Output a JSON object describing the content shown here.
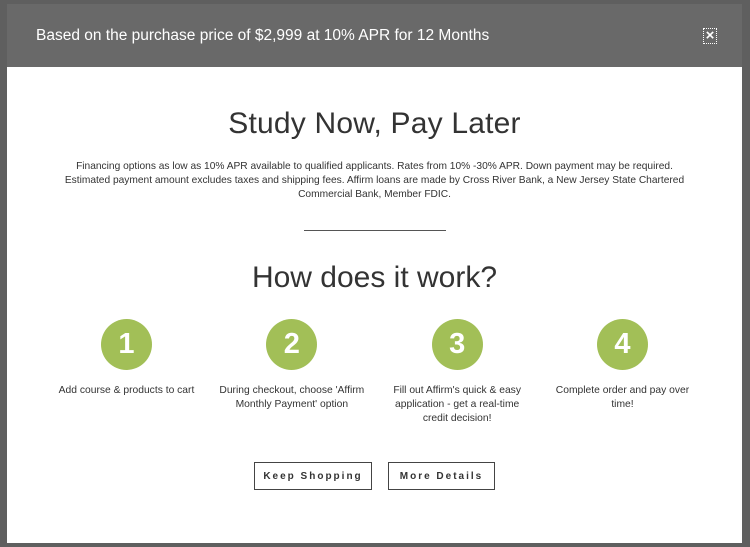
{
  "header": {
    "text": "Based on the purchase price of $2,999 at 10% APR for 12 Months",
    "close_label": "×"
  },
  "main": {
    "title": "Study Now, Pay Later",
    "disclaimer": "Financing options as low as 10% APR available to qualified applicants. Rates from 10% -30% APR. Down payment may be required. Estimated payment amount excludes taxes and shipping fees. Affirm loans are made by Cross River Bank, a New Jersey State Chartered Commercial Bank, Member FDIC.",
    "subtitle": "How does it work?",
    "steps": [
      {
        "number": "1",
        "text": "Add course & products to cart"
      },
      {
        "number": "2",
        "text": "During checkout, choose 'Affirm Monthly Payment' option"
      },
      {
        "number": "3",
        "text": "Fill out Affirm's quick & easy application - get a real-time credit decision!"
      },
      {
        "number": "4",
        "text": "Complete order and pay over time!"
      }
    ]
  },
  "buttons": {
    "keep_shopping": "Keep Shopping",
    "more_details": "More Details"
  },
  "colors": {
    "header_bg": "#696969",
    "accent_green": "#a2bf57",
    "overlay": "#5f5f5f"
  }
}
